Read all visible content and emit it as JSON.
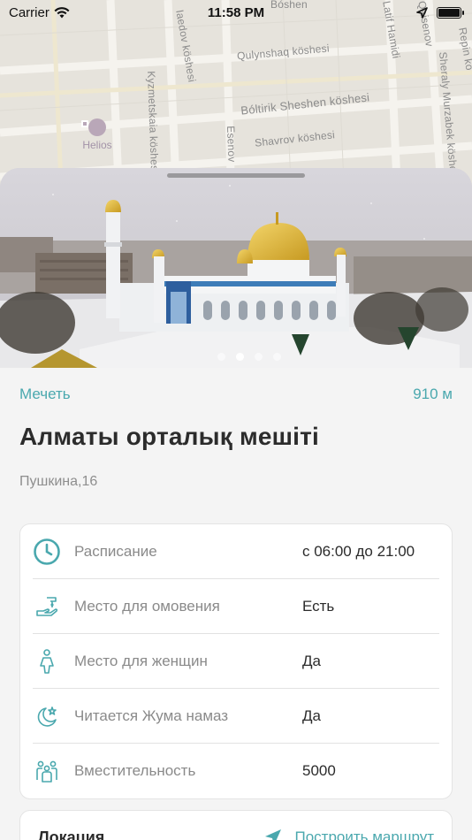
{
  "status_bar": {
    "carrier": "Carrier",
    "time": "11:58 PM"
  },
  "map": {
    "streets": [
      "Qulynshaq köshesi",
      "Bóltirik Sheshen köshesi",
      "Shavrov köshesi",
      "Kyzmetskaia köshesi",
      "Esenov",
      "Sheraly Murzabek köshesi",
      "Latif Hamidi",
      "Repin kö",
      "Bóshen",
      "Iaedov köshesi",
      "Qaisenov"
    ],
    "poi_label": "Helios"
  },
  "gallery": {
    "dot_count": 4,
    "active_index": 1
  },
  "place": {
    "category": "Мечеть",
    "distance": "910 м",
    "name": "Алматы орталық мешіті",
    "address": "Пушкина,16"
  },
  "details": [
    {
      "icon": "clock-icon",
      "label": "Расписание",
      "value": "с 06:00 до 21:00"
    },
    {
      "icon": "ablution-icon",
      "label": "Место для омовения",
      "value": "Есть"
    },
    {
      "icon": "woman-icon",
      "label": "Место для женщин",
      "value": "Да"
    },
    {
      "icon": "crescent-star-icon",
      "label": "Читается Жума намаз",
      "value": "Да"
    },
    {
      "icon": "people-icon",
      "label": "Вместительность",
      "value": "5000"
    }
  ],
  "location": {
    "title": "Локация",
    "route_label": "Построить маршрут"
  },
  "colors": {
    "accent": "#4aa8ae",
    "text": "#2c2c2c",
    "muted": "#8a8a8a"
  }
}
